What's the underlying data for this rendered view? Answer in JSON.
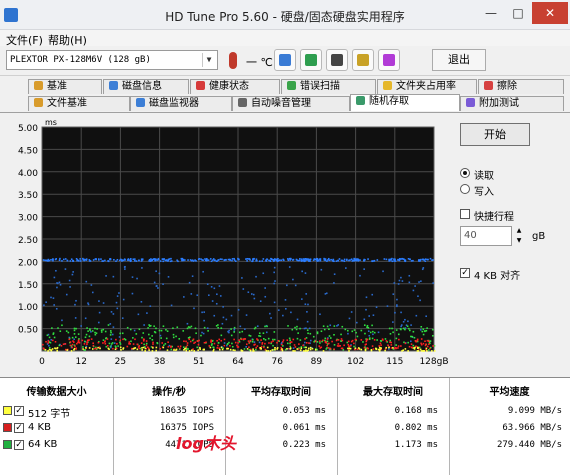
{
  "window": {
    "title": "HD Tune Pro 5.60 - 硬盘/固态硬盘实用程序",
    "minimize_glyph": "—",
    "maximize_glyph": "□",
    "close_glyph": "✕"
  },
  "menu": {
    "file": "文件(F)",
    "help": "帮助(H)"
  },
  "toolbar": {
    "drive": "PLEXTOR PX-128M6V (128 gB)",
    "temperature": "一 ℃",
    "exit_label": "退出",
    "icons": [
      {
        "name": "copy-icon",
        "color": "#3a7bd5"
      },
      {
        "name": "copy-all-icon",
        "color": "#2e9e4f"
      },
      {
        "name": "camera-icon",
        "color": "#444444"
      },
      {
        "name": "options-icon",
        "color": "#c9a227"
      },
      {
        "name": "download-icon",
        "color": "#b13bd6"
      }
    ]
  },
  "tabs": {
    "row1": [
      {
        "label": "基准",
        "icon": "benchmark-icon",
        "color": "#d89b2b"
      },
      {
        "label": "磁盘信息",
        "icon": "info-icon",
        "color": "#3d7fd6"
      },
      {
        "label": "健康状态",
        "icon": "health-icon",
        "color": "#d63a3a"
      },
      {
        "label": "错误扫描",
        "icon": "scan-icon",
        "color": "#3aa44a"
      },
      {
        "label": "文件夹占用率",
        "icon": "folder-icon",
        "color": "#e5b72b"
      },
      {
        "label": "擦除",
        "icon": "erase-icon",
        "color": "#d64040"
      }
    ],
    "row2": [
      {
        "label": "文件基准",
        "icon": "file-benchmark-icon",
        "color": "#d89b2b"
      },
      {
        "label": "磁盘监视器",
        "icon": "monitor-icon",
        "color": "#3d7fd6"
      },
      {
        "label": "自动噪音管理",
        "icon": "speaker-icon",
        "color": "#666666"
      },
      {
        "label": "随机存取",
        "icon": "random-access-icon",
        "color": "#3a9a6a"
      },
      {
        "label": "附加测试",
        "icon": "extra-tests-icon",
        "color": "#7a5bd6"
      }
    ]
  },
  "chart_data": {
    "type": "scatter",
    "y_unit": "ms",
    "x_unit": "gB",
    "ylim": [
      0,
      5
    ],
    "xlim": [
      0,
      128
    ],
    "y_ticks": [
      "5.00",
      "4.50",
      "4.00",
      "3.50",
      "3.00",
      "2.50",
      "2.00",
      "1.50",
      "1.00",
      "0.50"
    ],
    "x_ticks": [
      "0",
      "12",
      "25",
      "38",
      "51",
      "64",
      "76",
      "89",
      "102",
      "115",
      "128gB"
    ],
    "grid": true,
    "series": [
      {
        "name": "512 字节",
        "color": "#ffff40",
        "band_ms": 0.05
      },
      {
        "name": "4 KB",
        "color": "#ff2020",
        "band_ms": 0.168
      },
      {
        "name": "64 KB",
        "color": "#30e040",
        "band_ms": 0.22
      },
      {
        "color": "#2b7dff",
        "band_ms": 2.05
      }
    ]
  },
  "controls": {
    "start_label": "开始",
    "read_label": "读取",
    "write_label": "写入",
    "read_selected": true,
    "short_stroke_label": "快捷行程",
    "short_stroke_checked": false,
    "short_stroke_value": "40",
    "unit_label": "gB",
    "align_label": "4 KB 对齐",
    "align_checked": true
  },
  "results": {
    "headers": [
      "传输数据大小",
      "操作/秒",
      "平均存取时间",
      "最大存取时间",
      "平均速度"
    ],
    "rows": [
      {
        "size": "512 字节",
        "color": "#ffff40",
        "checked": true,
        "ops": "18635 IOPS",
        "avg": "0.053 ms",
        "max": "0.168 ms",
        "speed": "9.099 MB/s"
      },
      {
        "size": "4 KB",
        "color": "#d82020",
        "checked": true,
        "ops": "16375 IOPS",
        "avg": "0.061 ms",
        "max": "0.802 ms",
        "speed": "63.966 MB/s"
      },
      {
        "size": "64 KB",
        "color": "#20b040",
        "checked": true,
        "ops": "4471 IOPS",
        "avg": "0.223 ms",
        "max": "1.173 ms",
        "speed": "279.440 MB/s"
      }
    ]
  },
  "watermark": "log木头"
}
